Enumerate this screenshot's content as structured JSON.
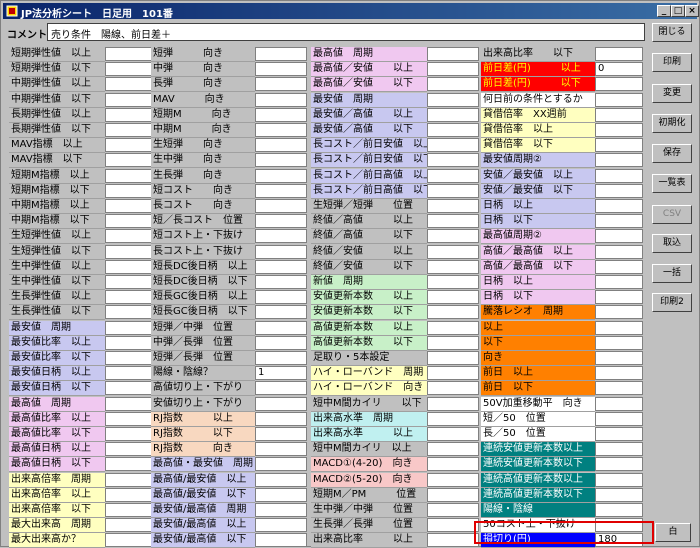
{
  "window": {
    "title": "JP法分析シート　日足用　101番"
  },
  "comment": {
    "label": "コメント",
    "value": "売り条件　陽線、前日差＋"
  },
  "columns": [
    {
      "label_width": 96,
      "input_width": 48,
      "rows": [
        {
          "label": "短期弾性値　以上",
          "color": "#c0c0c0"
        },
        {
          "label": "短期弾性値　以下",
          "color": "#c0c0c0"
        },
        {
          "label": "中期弾性値　以上",
          "color": "#c0c0c0"
        },
        {
          "label": "中期弾性値　以下",
          "color": "#c0c0c0"
        },
        {
          "label": "長期弾性値　以上",
          "color": "#c0c0c0"
        },
        {
          "label": "長期弾性値　以下",
          "color": "#c0c0c0"
        },
        {
          "label": "MAV指標　以上",
          "color": "#c0c0c0"
        },
        {
          "label": "MAV指標　以下",
          "color": "#c0c0c0"
        },
        {
          "label": "短期M指標　以上",
          "color": "#c0c0c0"
        },
        {
          "label": "短期M指標　以下",
          "color": "#c0c0c0"
        },
        {
          "label": "中期M指標　以上",
          "color": "#c0c0c0"
        },
        {
          "label": "中期M指標　以下",
          "color": "#c0c0c0"
        },
        {
          "label": "生短弾性値　以上",
          "color": "#c0c0c0"
        },
        {
          "label": "生短弾性値　以下",
          "color": "#c0c0c0"
        },
        {
          "label": "生中弾性値　以上",
          "color": "#c0c0c0"
        },
        {
          "label": "生中弾性値　以下",
          "color": "#c0c0c0"
        },
        {
          "label": "生長弾性値　以上",
          "color": "#c0c0c0"
        },
        {
          "label": "生長弾性値　以下",
          "color": "#c0c0c0"
        },
        {
          "label": "最安値　周期",
          "color": "#c8c8f0"
        },
        {
          "label": "最安値比率　以上",
          "color": "#c8c8f0"
        },
        {
          "label": "最安値比率　以下",
          "color": "#c8c8f0"
        },
        {
          "label": "最安値日柄　以上",
          "color": "#c8c8f0"
        },
        {
          "label": "最安値日柄　以下",
          "color": "#c8c8f0"
        },
        {
          "label": "最高値　周期",
          "color": "#f0c8f0"
        },
        {
          "label": "最高値比率　以上",
          "color": "#f0c8f0"
        },
        {
          "label": "最高値比率　以下",
          "color": "#f0c8f0"
        },
        {
          "label": "最高値日柄　以上",
          "color": "#f0c8f0"
        },
        {
          "label": "最高値日柄　以下",
          "color": "#f0c8f0"
        },
        {
          "label": "出来高倍率　周期",
          "color": "#ffffc0"
        },
        {
          "label": "出来高倍率　以上",
          "color": "#ffffc0"
        },
        {
          "label": "出来高倍率　以下",
          "color": "#ffffc0"
        },
        {
          "label": "最大出来高　周期",
          "color": "#ffffc0"
        },
        {
          "label": "最大出来高か？",
          "color": "#ffffc0"
        }
      ]
    },
    {
      "label_width": 104,
      "input_width": 52,
      "rows": [
        {
          "label": "短弾　　　向き",
          "color": "#c0c0c0"
        },
        {
          "label": "中弾　　　向き",
          "color": "#c0c0c0"
        },
        {
          "label": "長弾　　　向き",
          "color": "#c0c0c0"
        },
        {
          "label": "MAV　　　向き",
          "color": "#c0c0c0"
        },
        {
          "label": "短期M　　　向き",
          "color": "#c0c0c0"
        },
        {
          "label": "中期M　　　向き",
          "color": "#c0c0c0"
        },
        {
          "label": "生短弾　　向き",
          "color": "#c0c0c0"
        },
        {
          "label": "生中弾　　向き",
          "color": "#c0c0c0"
        },
        {
          "label": "生長弾　　向き",
          "color": "#c0c0c0"
        },
        {
          "label": "短コスト　　向き",
          "color": "#c0c0c0"
        },
        {
          "label": "長コスト　　向き",
          "color": "#c0c0c0"
        },
        {
          "label": "短／長コスト　位置",
          "color": "#c0c0c0"
        },
        {
          "label": "短コスト上・下抜け",
          "color": "#c0c0c0"
        },
        {
          "label": "長コスト上・下抜け",
          "color": "#c0c0c0"
        },
        {
          "label": "短長DC後日柄　以上",
          "color": "#c0c0c0"
        },
        {
          "label": "短長DC後日柄　以下",
          "color": "#c0c0c0"
        },
        {
          "label": "短長GC後日柄　以上",
          "color": "#c0c0c0"
        },
        {
          "label": "短長GC後日柄　以下",
          "color": "#c0c0c0"
        },
        {
          "label": "短弾／中弾　位置",
          "color": "#c0c0c0"
        },
        {
          "label": "中弾／長弾　位置",
          "color": "#c0c0c0"
        },
        {
          "label": "短弾／長弾　位置",
          "color": "#c0c0c0"
        },
        {
          "label": "陽線・陰線？",
          "color": "#c0c0c0"
        },
        {
          "label": "高値切り上・下がり",
          "color": "#c0c0c0"
        },
        {
          "label": "安値切り上・下がり",
          "color": "#c0c0c0"
        },
        {
          "label": "RJ指数　　　以上",
          "color": "#f8d8c0"
        },
        {
          "label": "RJ指数　　　以下",
          "color": "#f8d8c0"
        },
        {
          "label": "RJ指数　　　向き",
          "color": "#f8d8c0"
        },
        {
          "label": "最高値・最安値　周期",
          "color": "#c8c8f0"
        },
        {
          "label": "最高値/最安値　以上",
          "color": "#c8c8f0"
        },
        {
          "label": "最高値/最安値　以下",
          "color": "#c8c8f0"
        },
        {
          "label": "最安値/最高値　周期",
          "color": "#c8c8f0"
        },
        {
          "label": "最安値/最高値　以上",
          "color": "#c8c8f0"
        },
        {
          "label": "最安値/最高値　以下",
          "color": "#c8c8f0"
        }
      ]
    },
    {
      "label_width": 116,
      "input_width": 52,
      "rows": [
        {
          "label": "最高値　周期",
          "color": "#f0c8f0"
        },
        {
          "label": "最高値／安値　　以上",
          "color": "#f0c8f0"
        },
        {
          "label": "最高値／安値　　以下",
          "color": "#f0c8f0"
        },
        {
          "label": "最安値　周期",
          "color": "#c8c8f0"
        },
        {
          "label": "最安値／高値　　以上",
          "color": "#c8c8f0"
        },
        {
          "label": "最安値／高値　　以下",
          "color": "#c8c8f0"
        },
        {
          "label": "長コスト／前日安値　以上",
          "color": "#c8c8f0"
        },
        {
          "label": "長コスト／前日安値　以下",
          "color": "#c8c8f0"
        },
        {
          "label": "長コスト／前日高値　以上",
          "color": "#c8c8f0"
        },
        {
          "label": "長コスト／前日高値　以下",
          "color": "#c8c8f0"
        },
        {
          "label": "生短弾／短弾　　位置",
          "color": "#c0c0c0"
        },
        {
          "label": "終値／高値　　　以上",
          "color": "#c0c0c0"
        },
        {
          "label": "終値／高値　　　以下",
          "color": "#c0c0c0"
        },
        {
          "label": "終値／安値　　　以上",
          "color": "#c0c0c0"
        },
        {
          "label": "終値／安値　　　以下",
          "color": "#c0c0c0"
        },
        {
          "label": "新値　周期",
          "color": "#c8f0c8"
        },
        {
          "label": "安値更新本数　　以上",
          "color": "#c8f0c8"
        },
        {
          "label": "安値更新本数　　以下",
          "color": "#c8f0c8"
        },
        {
          "label": "高値更新本数　　以上",
          "color": "#c8f0c8"
        },
        {
          "label": "高値更新本数　　以下",
          "color": "#c8f0c8"
        },
        {
          "label": "足取り・5本設定",
          "color": "#c0c0c0"
        },
        {
          "label": "ハイ・ローバンド　周期",
          "color": "#ffffc0"
        },
        {
          "label": "ハイ・ローバンド　向き",
          "color": "#ffffc0"
        },
        {
          "label": "短中M間カイリ　　以下",
          "color": "#c0c0c0"
        },
        {
          "label": "出来高水準　周期",
          "color": "#c0f0f0"
        },
        {
          "label": "出来高水準　　　以上",
          "color": "#c0f0f0"
        },
        {
          "label": "短中M間カイリ　以上",
          "color": "#c0c0c0"
        },
        {
          "label": "MACD①(4-20)　向き",
          "color": "#f8c8c8"
        },
        {
          "label": "MACD②(5-20)　向き",
          "color": "#f8c8c8"
        },
        {
          "label": "短期M／PM　　　位置",
          "color": "#c0c0c0"
        },
        {
          "label": "生中弾／中弾　　位置",
          "color": "#c0c0c0"
        },
        {
          "label": "生長弾／長弾　　位置",
          "color": "#c0c0c0"
        },
        {
          "label": "出来高比率　　　以上",
          "color": "#c0c0c0"
        }
      ]
    },
    {
      "label_width": 114,
      "input_width": 48,
      "rows": [
        {
          "label": "出来高比率　　以下",
          "color": "#c0c0c0"
        },
        {
          "label": "前日差(円)　　　以上",
          "color": "#ff0000",
          "fg": "#ffff00"
        },
        {
          "label": "前日差(円)　　　以下",
          "color": "#ff0000",
          "fg": "#ffff00"
        },
        {
          "label": "何日前の条件とするか",
          "color": "#ffffff"
        },
        {
          "label": "貸借倍率　XX週前",
          "color": "#ffffc0"
        },
        {
          "label": "貸借倍率　以上",
          "color": "#ffffc0"
        },
        {
          "label": "貸借倍率　以下",
          "color": "#ffffc0"
        },
        {
          "label": "最安値周期②",
          "color": "#c8c8f0"
        },
        {
          "label": "安値／最安値　以上",
          "color": "#c8c8f0"
        },
        {
          "label": "安値／最安値　以下",
          "color": "#c8c8f0"
        },
        {
          "label": "日柄　以上",
          "color": "#c8c8f0"
        },
        {
          "label": "日柄　以下",
          "color": "#c8c8f0"
        },
        {
          "label": "最高値周期②",
          "color": "#f0c8f0"
        },
        {
          "label": "高値／最高値　以上",
          "color": "#f0c8f0"
        },
        {
          "label": "高値／最高値　以下",
          "color": "#f0c8f0"
        },
        {
          "label": "日柄　以上",
          "color": "#f0c8f0"
        },
        {
          "label": "日柄　以下",
          "color": "#f0c8f0"
        },
        {
          "label": "騰落レシオ　周期",
          "color": "#ff8000"
        },
        {
          "label": "以上",
          "color": "#ff8000"
        },
        {
          "label": "以下",
          "color": "#ff8000"
        },
        {
          "label": "向き",
          "color": "#ff8000"
        },
        {
          "label": "前日　以上",
          "color": "#ff8000"
        },
        {
          "label": "前日　以下",
          "color": "#ff8000"
        },
        {
          "label": "50V加重移動平　向き",
          "color": "#ffffff"
        },
        {
          "label": "短／50　位置",
          "color": "#ffffff"
        },
        {
          "label": "長／50　位置",
          "color": "#ffffff"
        },
        {
          "label": "連続安値更新本数以上",
          "color": "#008080",
          "fg": "#ffffff"
        },
        {
          "label": "連続安値更新本数以下",
          "color": "#008080",
          "fg": "#ffffff"
        },
        {
          "label": "連続高値更新本数以上",
          "color": "#008080",
          "fg": "#ffffff"
        },
        {
          "label": "連続高値更新本数以下",
          "color": "#008080",
          "fg": "#ffffff"
        },
        {
          "label": "陽線・陰線",
          "color": "#008080",
          "fg": "#ffffff"
        },
        {
          "label": "50コスト上・下抜け",
          "color": "#ffffff"
        },
        {
          "label": "損切り(円)",
          "color": "#0000ff",
          "fg": "#ffffff"
        }
      ]
    }
  ],
  "input_values": {
    "col1_row21": "1",
    "col3_row1": "0",
    "col3_row32": "180"
  },
  "buttons": [
    {
      "name": "close-button",
      "label": "閉じる",
      "dim": false
    },
    {
      "name": "print-button",
      "label": "印刷",
      "dim": false
    },
    {
      "name": "change-button",
      "label": "変更",
      "dim": false
    },
    {
      "name": "reset-button",
      "label": "初期化",
      "dim": false
    },
    {
      "name": "save-button",
      "label": "保存",
      "dim": false
    },
    {
      "name": "list-button",
      "label": "一覧表",
      "dim": false
    },
    {
      "name": "csv-button",
      "label": "CSV",
      "dim": true
    },
    {
      "name": "import-button",
      "label": "取込",
      "dim": false
    },
    {
      "name": "batch-button",
      "label": "一括",
      "dim": false
    },
    {
      "name": "print2-button",
      "label": "印刷2",
      "dim": false
    }
  ],
  "bottom_button": {
    "label": "白"
  },
  "colors": {
    "highlight": "#e00000",
    "titlebar": "#0a246a"
  }
}
